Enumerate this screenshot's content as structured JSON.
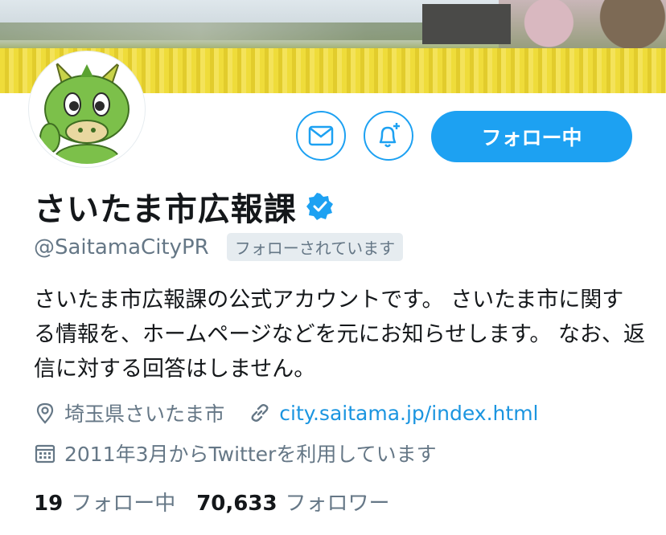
{
  "profile": {
    "display_name": "さいたま市広報課",
    "handle": "@SaitamaCityPR",
    "follows_you": "フォローされています",
    "bio": "さいたま市広報課の公式アカウントです。 さいたま市に関する情報を、ホームページなどを元にお知らせします。 なお、返信に対する回答はしません。",
    "location": "埼玉県さいたま市",
    "website": "city.saitama.jp/index.html",
    "joined": "2011年3月からTwitterを利用しています"
  },
  "actions": {
    "follow_label": "フォロー中"
  },
  "stats": {
    "following_count": "19",
    "following_label": "フォロー中",
    "followers_count": "70,633",
    "followers_label": "フォロワー"
  },
  "colors": {
    "accent": "#1da1f2",
    "link": "#1b95e0",
    "muted": "#657786"
  },
  "icons": [
    "mail-icon",
    "bell-plus-icon",
    "verified-badge-icon",
    "location-pin-icon",
    "link-icon",
    "calendar-icon"
  ]
}
